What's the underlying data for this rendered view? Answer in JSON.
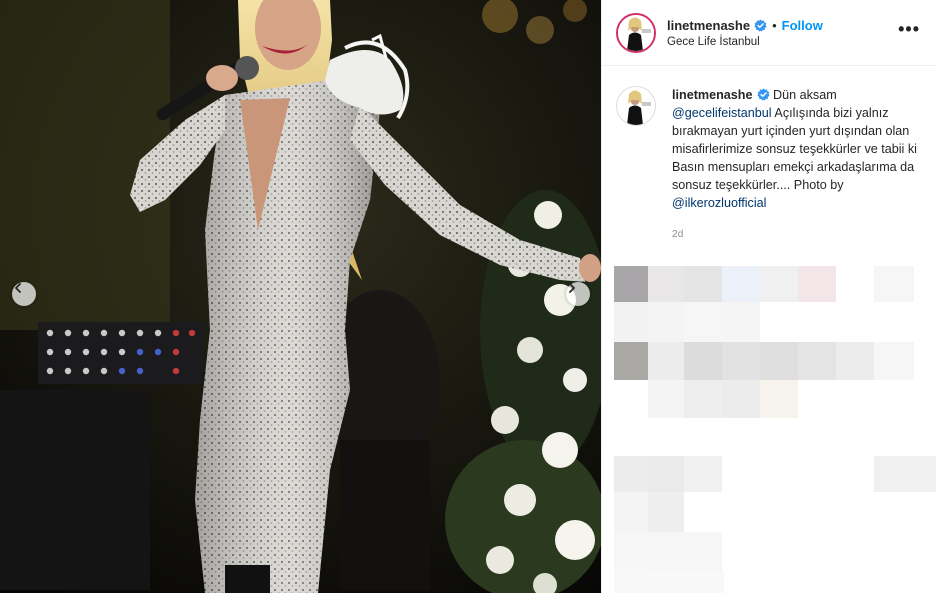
{
  "post": {
    "username": "linetmenashe",
    "follow_label": "Follow",
    "location": "Gece Life İstanbul",
    "more_label": "•••",
    "separator": "•"
  },
  "caption": {
    "username": "linetmenashe",
    "text_1": " Dün aksam ",
    "mention_1": "@gecelifeistanbul",
    "text_2": " Açılışında bizi yalnız bırakmayan yurt içinden yurt dışından olan misafirlerimize sonsuz teşekkürler ve tabii ki Basın mensupları emekçi arkadaşlarıma da sonsuz teşekkürler.... Photo by ",
    "mention_2": "@ilkerozluofficial",
    "time": "2d"
  },
  "colors": {
    "accent": "#0095f6",
    "verified": "#3897f0",
    "mention": "#00376b",
    "story_ring": "#d32d6a"
  },
  "icons": {
    "prev": "chevron-left-icon",
    "next": "chevron-right-icon",
    "verified": "verified-badge-icon",
    "more": "more-options-icon"
  }
}
